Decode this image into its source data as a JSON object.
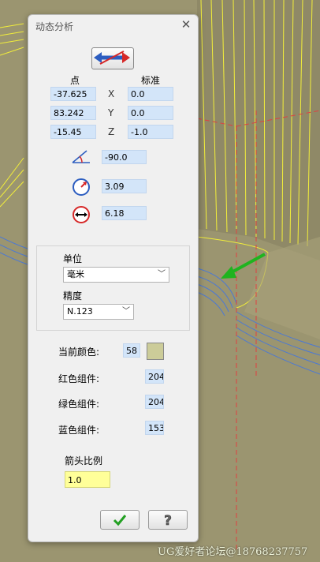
{
  "dialog": {
    "title": "动态分析",
    "close_icon": "close-icon"
  },
  "headers": {
    "point": "点",
    "standard": "标准"
  },
  "point": {
    "x": "-37.625",
    "y": "83.242",
    "z": "-15.45"
  },
  "axes": {
    "x": "X",
    "y": "Y",
    "z": "Z"
  },
  "standard": {
    "x": "0.0",
    "y": "0.0",
    "z": "-1.0"
  },
  "angle": "-90.0",
  "radius": "3.09",
  "diameter": "6.18",
  "units": {
    "label": "单位",
    "value": "毫米"
  },
  "precision": {
    "label": "精度",
    "value": "N.123"
  },
  "color": {
    "current_label": "当前颜色:",
    "current_value": "58",
    "red_label": "红色组件:",
    "red_value": "204",
    "green_label": "绿色组件:",
    "green_value": "204",
    "blue_label": "蓝色组件:",
    "blue_value": "153",
    "swatch": "#cccc99"
  },
  "arrow_scale": {
    "label": "箭头比例",
    "value": "1.0"
  },
  "buttons": {
    "ok_icon": "checkmark-icon",
    "help_icon": "help-icon"
  },
  "watermark": "UG爱好者论坛@18768237757"
}
